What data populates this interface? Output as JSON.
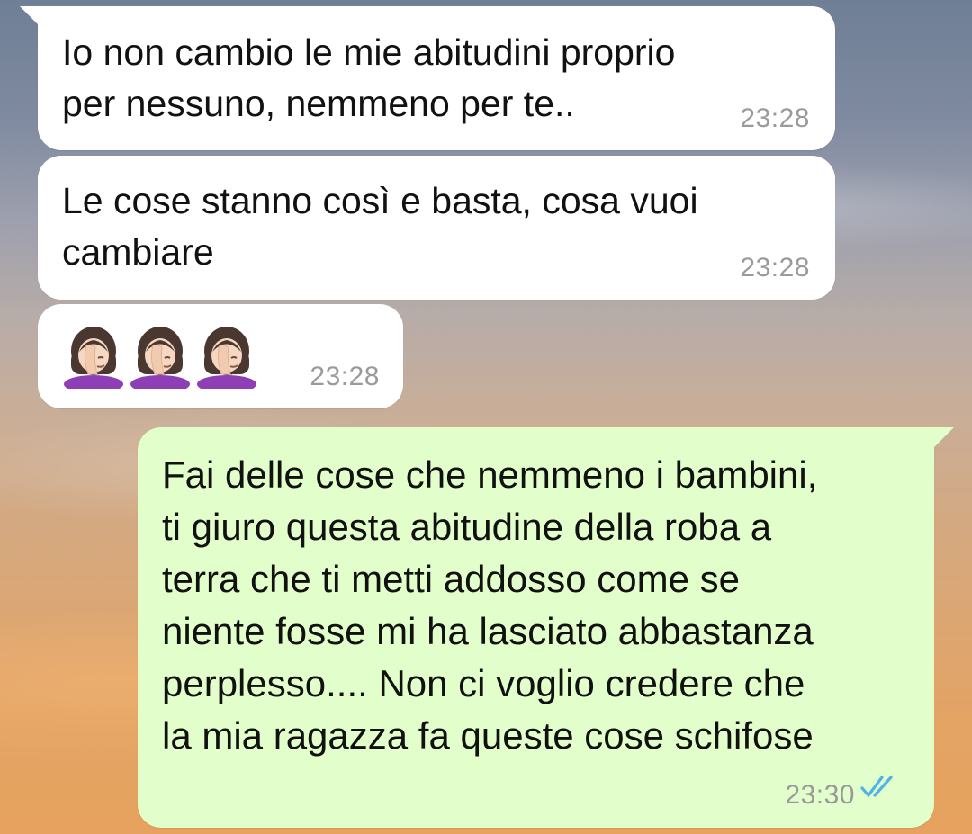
{
  "messages": [
    {
      "direction": "incoming",
      "text": "Io non cambio le mie abitudini proprio\nper nessuno, nemmeno per te..",
      "time": "23:28"
    },
    {
      "direction": "incoming",
      "text": "Le cose stanno così e basta, cosa vuoi\ncambiare",
      "time": "23:28"
    },
    {
      "direction": "incoming",
      "emoji": [
        "woman-facepalming-icon",
        "woman-facepalming-icon",
        "woman-facepalming-icon"
      ],
      "time": "23:28"
    },
    {
      "direction": "outgoing",
      "text": "Fai delle cose che nemmeno i bambini,\nti giuro questa abitudine della roba a\nterra che ti metti addosso come se\nniente fosse mi ha lasciato abbastanza\nperplesso.... Non ci voglio credere che\nla mia ragazza fa queste cose schifose",
      "time": "23:30",
      "status": "read"
    }
  ],
  "colors": {
    "incoming_bubble": "#ffffff",
    "outgoing_bubble": "#e2ffcb",
    "timestamp": "#9a9a9a",
    "read_ticks": "#4fb3e8"
  }
}
